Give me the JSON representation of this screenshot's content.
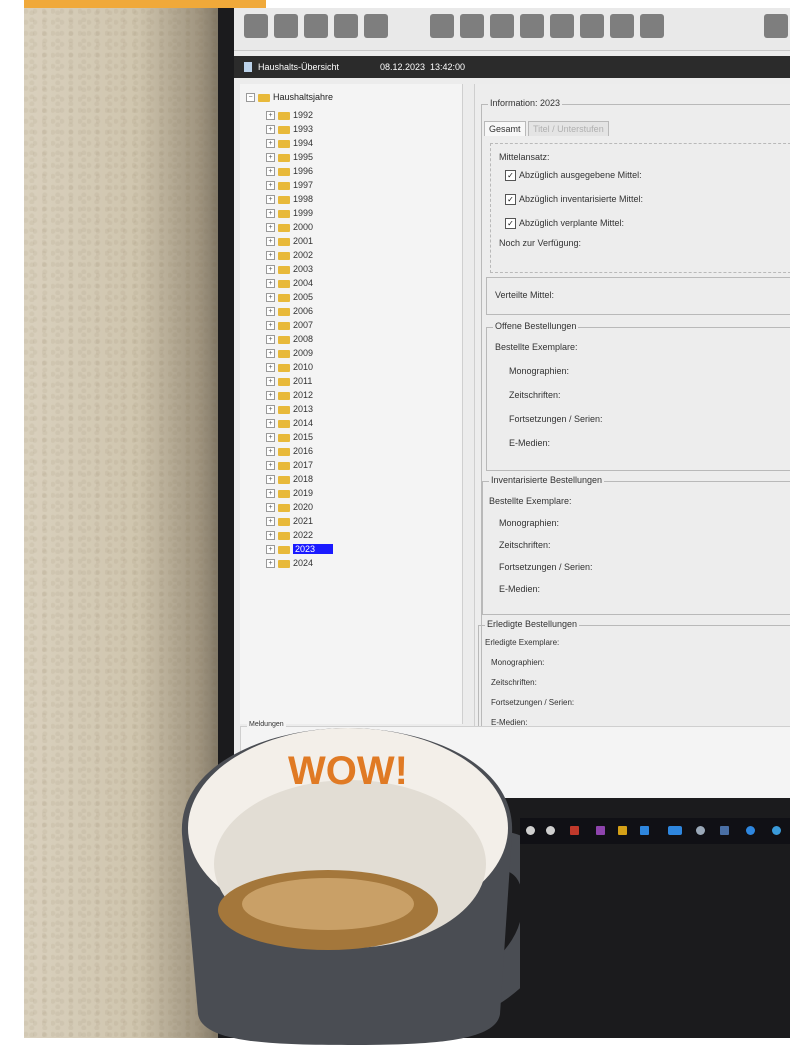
{
  "window": {
    "title": "Haushalts-Übersicht",
    "date": "08.12.2023",
    "time": "13:42:00"
  },
  "tree": {
    "root": "Haushaltsjahre",
    "years": [
      "1992",
      "1993",
      "1994",
      "1995",
      "1996",
      "1997",
      "1998",
      "1999",
      "2000",
      "2001",
      "2002",
      "2003",
      "2004",
      "2005",
      "2006",
      "2007",
      "2008",
      "2009",
      "2010",
      "2011",
      "2012",
      "2013",
      "2014",
      "2015",
      "2016",
      "2017",
      "2018",
      "2019",
      "2020",
      "2021",
      "2022",
      "2023",
      "2024"
    ],
    "selected": "2023"
  },
  "info": {
    "group_title": "Information: 2023",
    "tabs": [
      "Gesamt",
      "Titel / Unterstufen"
    ],
    "active_tab": "Gesamt",
    "mittelansatz": {
      "label": "Mittelansatz:",
      "checks": [
        {
          "label": "Abzüglich ausgegebene Mittel:",
          "checked": true
        },
        {
          "label": "Abzüglich inventarisierte Mittel:",
          "checked": true
        },
        {
          "label": "Abzüglich verplante Mittel:",
          "checked": true
        }
      ],
      "remaining": "Noch zur Verfügung:"
    },
    "verteilte": "Verteilte Mittel:",
    "offene": {
      "title": "Offene Bestellungen",
      "bestellte": "Bestellte Exemplare:",
      "items": [
        "Monographien:",
        "Zeitschriften:",
        "Fortsetzungen / Serien:",
        "E-Medien:"
      ]
    },
    "inventarisierte": {
      "title": "Inventarisierte Bestellungen",
      "bestellte": "Bestellte Exemplare:",
      "items": [
        "Monographien:",
        "Zeitschriften:",
        "Fortsetzungen / Serien:",
        "E-Medien:"
      ]
    },
    "erledigte": {
      "title": "Erledigte Bestellungen",
      "bestellte": "Erledigte Exemplare:",
      "items": [
        "Monographien:",
        "Zeitschriften:",
        "Fortsetzungen / Serien:",
        "E-Medien:"
      ]
    }
  },
  "messages_label": "Meldungen",
  "mug": {
    "text": "WOW!",
    "text_color": "#e07a24",
    "body_color": "#4a4d53"
  },
  "colors": {
    "accent_bar": "#f0a93a",
    "selection": "#1a1aff",
    "folder": "#e8b93a"
  }
}
